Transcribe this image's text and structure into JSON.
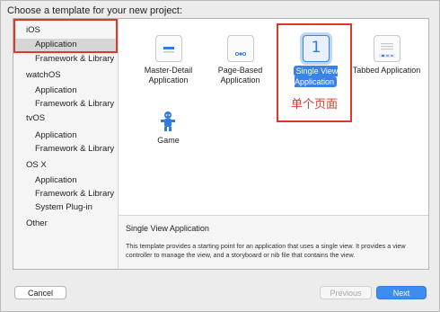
{
  "dialog": {
    "title": "Choose a template for your new project:"
  },
  "sidebar": {
    "sections": [
      {
        "header": "iOS",
        "items": [
          "Application",
          "Framework & Library"
        ]
      },
      {
        "header": "watchOS",
        "items": [
          "Application",
          "Framework & Library"
        ]
      },
      {
        "header": "tvOS",
        "items": [
          "Application",
          "Framework & Library"
        ]
      },
      {
        "header": "OS X",
        "items": [
          "Application",
          "Framework & Library",
          "System Plug-in"
        ]
      },
      {
        "header": "Other",
        "items": []
      }
    ],
    "selected": "iOS / Application"
  },
  "templates": [
    {
      "label": "Master-Detail Application",
      "icon": "master-detail-icon",
      "selected": false
    },
    {
      "label": "Page-Based Application",
      "icon": "page-based-icon",
      "selected": false
    },
    {
      "label": "Single View Application",
      "icon": "single-view-icon",
      "glyph": "1",
      "selected": true
    },
    {
      "label": "Tabbed Application",
      "icon": "tabbed-icon",
      "selected": false
    },
    {
      "label": "Game",
      "icon": "game-icon",
      "selected": false
    }
  ],
  "annotation": {
    "note": "单个页面"
  },
  "description": {
    "title": "Single View Application",
    "body": "This template provides a starting point for an application that uses a single view. It provides a view controller to manage the view, and a storyboard or nib file that contains the view."
  },
  "buttons": {
    "cancel": "Cancel",
    "previous": "Previous",
    "next": "Next"
  },
  "colors": {
    "accent": "#3b82e6",
    "annotation": "#d93a2b"
  }
}
